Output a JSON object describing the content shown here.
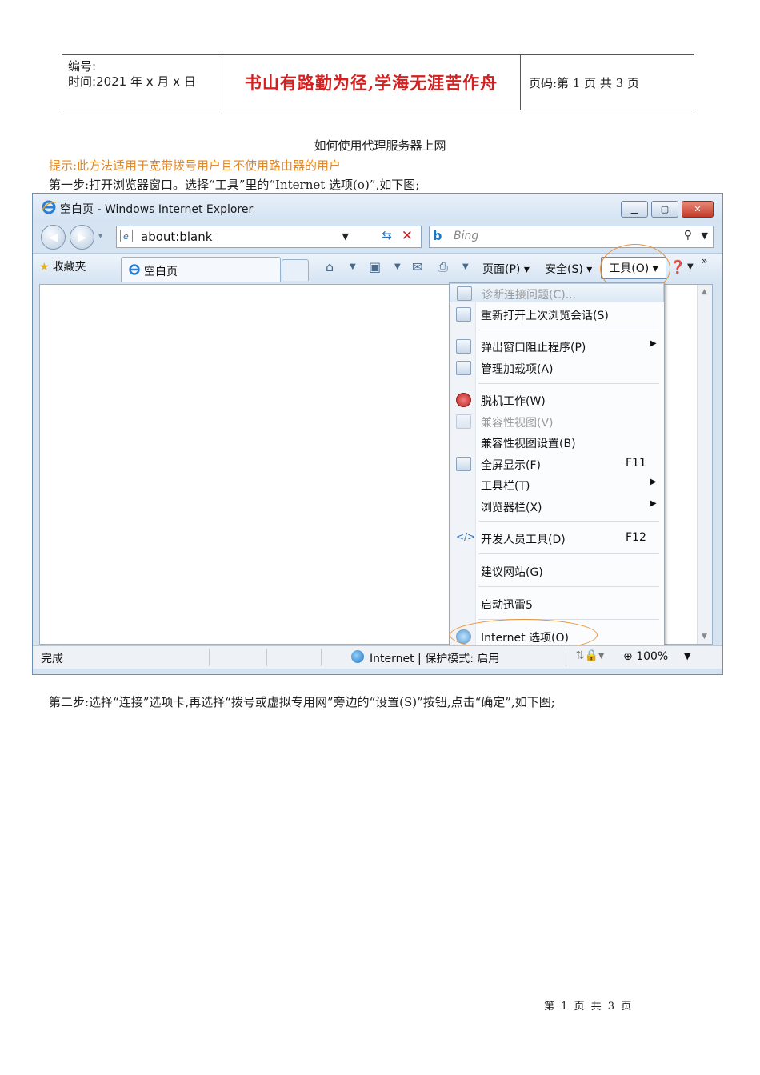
{
  "header": {
    "number_label": "编号:",
    "time_label": "时间:2021 年 x 月 x 日",
    "motto": "书山有路勤为径,学海无涯苦作舟",
    "page_info": "页码:第 1 页  共 3 页"
  },
  "doc": {
    "title": "如何使用代理服务器上网",
    "tip": "提示:此方法适用于宽带拨号用户且不使用路由器的用户",
    "step1": "第一步:打开浏览器窗口。选择“工具”里的“Internet 选项(o)”,如下图;",
    "step2": "第二步:选择“连接”选项卡,再选择“拨号或虚拟专用网”旁边的“设置(S)”按钮,点击“确定”,如下图;",
    "footer": "第 1 页 共 3 页"
  },
  "ie": {
    "window_title": "空白页 - Windows Internet Explorer",
    "address": "about:blank",
    "search_placeholder": "Bing",
    "search_brand": "b",
    "favorites": "收藏夹",
    "tab_label": "空白页",
    "cmd_page": "页面(P) ▾",
    "cmd_safety": "安全(S) ▾",
    "cmd_tools": "工具(O) ▾",
    "cmd_more": "»",
    "menu": [
      {
        "label": "诊断连接问题(C)...",
        "disabled": true
      },
      {
        "label": "重新打开上次浏览会话(S)"
      },
      {
        "label": "弹出窗口阻止程序(P)",
        "submenu": true
      },
      {
        "label": "管理加载项(A)"
      },
      {
        "label": "脱机工作(W)"
      },
      {
        "label": "兼容性视图(V)",
        "disabled": true
      },
      {
        "label": "兼容性视图设置(B)"
      },
      {
        "label": "全屏显示(F)",
        "shortcut": "F11"
      },
      {
        "label": "工具栏(T)",
        "submenu": true
      },
      {
        "label": "浏览器栏(X)",
        "submenu": true
      },
      {
        "label": "开发人员工具(D)",
        "shortcut": "F12"
      },
      {
        "label": "建议网站(G)"
      },
      {
        "label": "启动迅雷5"
      },
      {
        "label": "Internet 选项(O)"
      }
    ],
    "status": {
      "done": "完成",
      "zone": "Internet | 保护模式: 启用",
      "zoom": "100%"
    },
    "colors": {
      "accent_ellipse": "#e8923a",
      "motto_red": "#d42020",
      "tip_orange": "#e0882a"
    }
  }
}
